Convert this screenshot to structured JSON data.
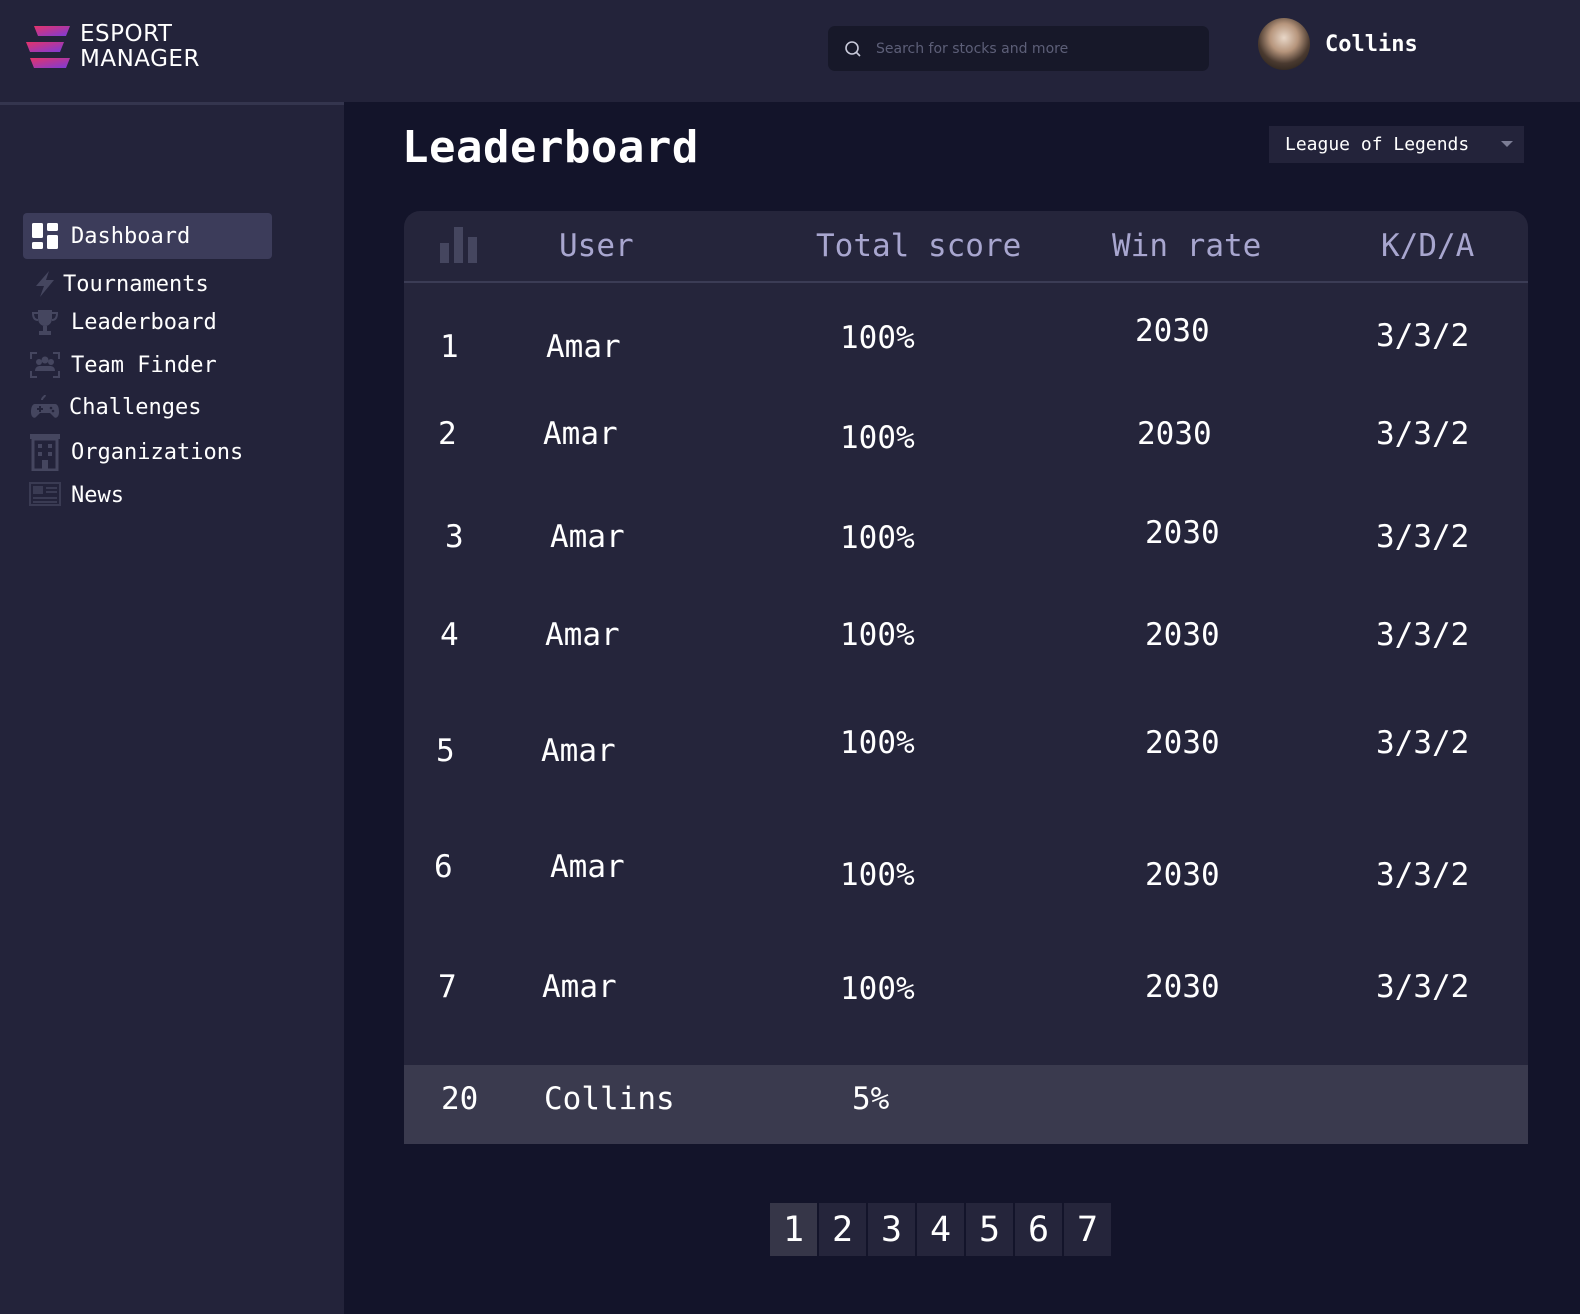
{
  "brand": {
    "line1": "ESPORT",
    "line2": "MANAGER"
  },
  "search": {
    "placeholder": "Search for stocks and more"
  },
  "user": {
    "name": "Collins"
  },
  "sidebar": {
    "items": [
      {
        "label": "Dashboard",
        "icon": "dashboard-icon",
        "active": true
      },
      {
        "label": "Tournaments",
        "icon": "lightning-icon"
      },
      {
        "label": "Leaderboard",
        "icon": "trophy-icon"
      },
      {
        "label": "Team Finder",
        "icon": "team-finder-icon"
      },
      {
        "label": "Challenges",
        "icon": "gamepad-icon"
      },
      {
        "label": "Organizations",
        "icon": "building-icon"
      },
      {
        "label": "News",
        "icon": "news-icon"
      }
    ]
  },
  "main": {
    "title": "Leaderboard",
    "game_select": {
      "value": "League of Legends"
    }
  },
  "table": {
    "headers": {
      "rank_icon": "bar-chart-icon",
      "user": "User",
      "total_score": "Total score",
      "win_rate": "Win rate",
      "kda": "K/D/A"
    },
    "rows": [
      {
        "rank": "1",
        "user": "Amar",
        "total_score": "100%",
        "win_rate": "2030",
        "kda": "3/3/2"
      },
      {
        "rank": "2",
        "user": "Amar",
        "total_score": "100%",
        "win_rate": "2030",
        "kda": "3/3/2"
      },
      {
        "rank": "3",
        "user": "Amar",
        "total_score": "100%",
        "win_rate": "2030",
        "kda": "3/3/2"
      },
      {
        "rank": "4",
        "user": "Amar",
        "total_score": "100%",
        "win_rate": "2030",
        "kda": "3/3/2"
      },
      {
        "rank": "5",
        "user": "Amar",
        "total_score": "100%",
        "win_rate": "2030",
        "kda": "3/3/2"
      },
      {
        "rank": "6",
        "user": "Amar",
        "total_score": "100%",
        "win_rate": "2030",
        "kda": "3/3/2"
      },
      {
        "rank": "7",
        "user": "Amar",
        "total_score": "100%",
        "win_rate": "2030",
        "kda": "3/3/2"
      }
    ],
    "current_user_row": {
      "rank": "20",
      "user": "Collins",
      "total_score": "5%"
    }
  },
  "pagination": {
    "pages": [
      "1",
      "2",
      "3",
      "4",
      "5",
      "6",
      "7"
    ],
    "current": "1"
  },
  "colors": {
    "background": "#13142a",
    "panel": "#23233a",
    "table": "#25253b",
    "header_text": "#a8a6cf",
    "accent_pink": "#d6336c",
    "accent_purple": "#7a3bd6"
  }
}
